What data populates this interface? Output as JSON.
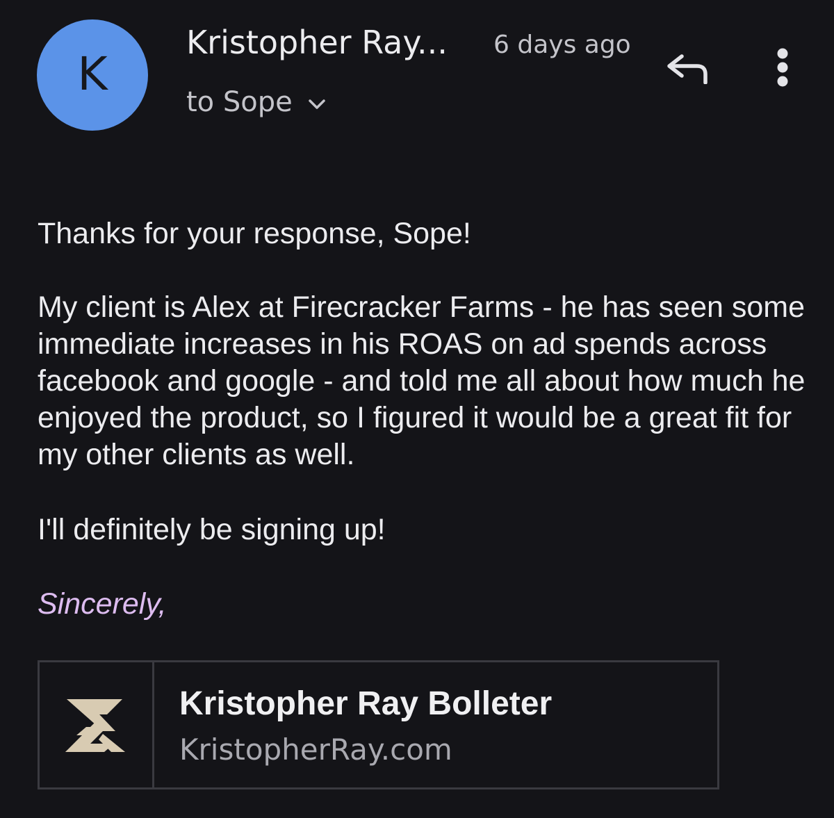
{
  "header": {
    "avatar_letter": "K",
    "avatar_color": "#5b93e8",
    "sender_name": "Kristopher Ray...",
    "timestamp": "6 days ago",
    "recipient_label": "to Sope",
    "reply_icon": "reply-icon",
    "more_icon": "more-vertical-icon",
    "expand_icon": "chevron-down-icon"
  },
  "message": {
    "greeting": "Thanks for your response, Sope!",
    "paragraph": "My client is Alex at Firecracker Farms - he has seen some immediate increases in his ROAS on ad spends across facebook and google - and told me all about how much he enjoyed the product, so I figured it would be a great fit for my other clients as well.",
    "closing_line": "I'll definitely be signing up!",
    "signoff": "Sincerely,",
    "signoff_color": "#ddbcf0"
  },
  "signature": {
    "logo_icon": "brand-logo-icon",
    "logo_color": "#d8cbb2",
    "name": "Kristopher Ray Bolleter",
    "website": "KristopherRay.com"
  }
}
